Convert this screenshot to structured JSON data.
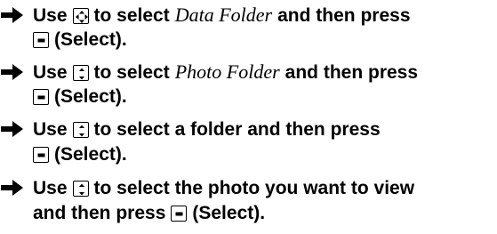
{
  "steps": [
    {
      "line1": {
        "before": "Use",
        "mid": "to select",
        "italic": "Data Folder",
        "after": "and then press"
      },
      "line2": {
        "after": "(Select)."
      },
      "key1": "dpad-4way-icon"
    },
    {
      "line1": {
        "before": "Use",
        "mid": "to select",
        "italic": "Photo Folder",
        "after": "and then press"
      },
      "line2": {
        "after": "(Select)."
      },
      "key1": "dpad-updown-icon"
    },
    {
      "line1": {
        "before": "Use",
        "mid": "to select a folder and then press"
      },
      "line2": {
        "after": "(Select)."
      },
      "key1": "dpad-updown-icon"
    },
    {
      "line1": {
        "before": "Use",
        "mid": "to select the photo you want to view"
      },
      "line2": {
        "before": "and then press",
        "after": "(Select)."
      },
      "key1": "dpad-updown-icon"
    }
  ],
  "icons": {
    "bullet": "arrow-right-icon",
    "select_key": "select-button-icon"
  }
}
